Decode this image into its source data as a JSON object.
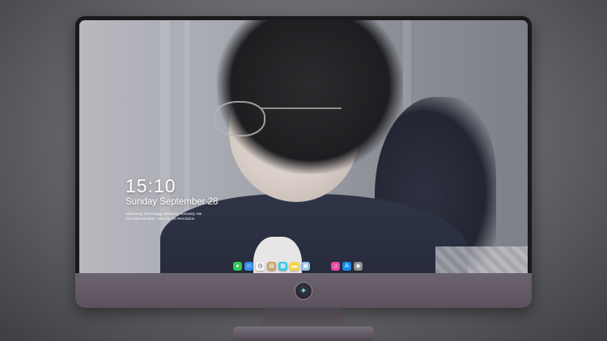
{
  "lock_screen": {
    "time": "15:10",
    "date": "Sunday September 28",
    "line1": "Advancing Technology. Elevating Humanity. Me",
    "line2": "Your time remains - Are you the Revolution"
  },
  "dock": {
    "items": [
      {
        "name": "messages",
        "glyph": "●",
        "color": "#34c759"
      },
      {
        "name": "finder",
        "glyph": "☺",
        "color": "#3a8ee6"
      },
      {
        "name": "clock",
        "glyph": "◷",
        "color": "#f2f2f2"
      },
      {
        "name": "contacts",
        "glyph": "▤",
        "color": "#c9a36a"
      },
      {
        "name": "claquette",
        "glyph": "▦",
        "color": "#40c8e0"
      },
      {
        "name": "notes",
        "glyph": "▬",
        "color": "#f5d547"
      },
      {
        "name": "photos",
        "glyph": "▣",
        "color": "#8fc1e8"
      },
      {
        "name": "music",
        "glyph": "♫",
        "color": "#e84aa6"
      },
      {
        "name": "app-store",
        "glyph": "A",
        "color": "#1c8cf0"
      },
      {
        "name": "camera",
        "glyph": "◉",
        "color": "#8e8e93"
      }
    ]
  },
  "monitor": {
    "logo_glyph": "✦",
    "accent": "#7fd3ff"
  }
}
